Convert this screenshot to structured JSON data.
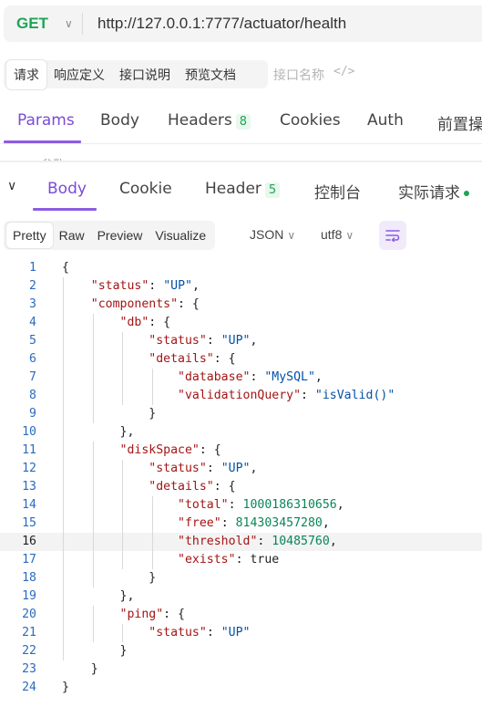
{
  "url_bar": {
    "method": "GET",
    "url": "http://127.0.0.1:7777/actuator/health"
  },
  "sub_tabs": [
    "请求",
    "响应定义",
    "接口说明",
    "预览文档"
  ],
  "interface_name_placeholder": "接口名称",
  "request_tabs": {
    "params": "Params",
    "body": "Body",
    "headers": "Headers",
    "headers_count": "8",
    "cookies": "Cookies",
    "auth": "Auth",
    "pre": "前置操"
  },
  "cut_text": "Query 参数",
  "response_tabs": {
    "body": "Body",
    "cookie": "Cookie",
    "header": "Header",
    "header_count": "5",
    "console": "控制台",
    "actual": "实际请求"
  },
  "view_modes": [
    "Pretty",
    "Raw",
    "Preview",
    "Visualize"
  ],
  "format": "JSON",
  "encoding": "utf8",
  "icons": {
    "method_dropdown": "chevron-down-icon",
    "code": "code-icon",
    "collapse": "chevron-down-icon",
    "format": "wrap-lines-icon"
  },
  "colors": {
    "accent": "#7b4bd8",
    "method_get": "#1ea556"
  },
  "code_lines": [
    "{",
    "    \"status\": \"UP\",",
    "    \"components\": {",
    "        \"db\": {",
    "            \"status\": \"UP\",",
    "            \"details\": {",
    "                \"database\": \"MySQL\",",
    "                \"validationQuery\": \"isValid()\"",
    "            }",
    "        },",
    "        \"diskSpace\": {",
    "            \"status\": \"UP\",",
    "            \"details\": {",
    "                \"total\": 1000186310656,",
    "                \"free\": 814303457280,",
    "                \"threshold\": 10485760,",
    "                \"exists\": true",
    "            }",
    "        },",
    "        \"ping\": {",
    "            \"status\": \"UP\"",
    "        }",
    "    }",
    "}"
  ],
  "current_line": 16
}
